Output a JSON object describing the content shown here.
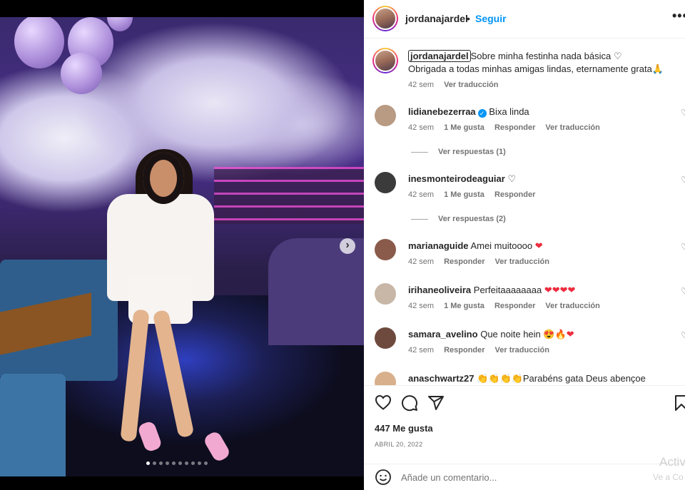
{
  "post": {
    "username": "jordanajardel",
    "separator": "•",
    "follow_label": "Seguir",
    "more_label": "•••",
    "caption_line1": "Sobre minha festinha nada básica ♡",
    "caption_line2": "Obrigada a todas minhas amigas lindas, eternamente grata🙏",
    "caption_time": "42 sem",
    "caption_translate": "Ver traducción",
    "likes": "447 Me gusta",
    "date": "ABRIL 20, 2022",
    "comment_placeholder": "Añade un comentario...",
    "carousel": {
      "total_slides": 10,
      "active_slide": 1
    }
  },
  "comments": [
    {
      "user": "lidianebezerraa",
      "verified": true,
      "text": "Bixa linda",
      "time": "42 sem",
      "likes": "1 Me gusta",
      "reply": "Responder",
      "translate": "Ver traducción",
      "replies": "Ver respuestas (1)"
    },
    {
      "user": "inesmonteirodeaguiar",
      "verified": false,
      "text": "♡",
      "time": "42 sem",
      "likes": "1 Me gusta",
      "reply": "Responder",
      "translate": "",
      "replies": "Ver respuestas (2)"
    },
    {
      "user": "marianaguide",
      "verified": false,
      "text": "Amei muitoooo ❤",
      "time": "42 sem",
      "likes": "",
      "reply": "Responder",
      "translate": "Ver traducción",
      "replies": ""
    },
    {
      "user": "irihaneoliveira",
      "verified": false,
      "text": "Perfeitaaaaaaaa ❤❤❤❤",
      "time": "42 sem",
      "likes": "1 Me gusta",
      "reply": "Responder",
      "translate": "Ver traducción",
      "replies": ""
    },
    {
      "user": "samara_avelino",
      "verified": false,
      "text": "Que noite hein 😍🔥❤",
      "time": "42 sem",
      "likes": "",
      "reply": "Responder",
      "translate": "Ver traducción",
      "replies": ""
    },
    {
      "user": "anaschwartz27",
      "verified": false,
      "text": "👏👏👏👏Parabéns gata Deus abençoe",
      "time": "",
      "likes": "",
      "reply": "",
      "translate": "",
      "replies": ""
    }
  ],
  "watermark": {
    "line1": "Activ",
    "line2": "Ve a Co"
  },
  "icons": {
    "heart": "heart-icon",
    "comment": "comment-icon",
    "share": "send-icon",
    "save": "bookmark-icon",
    "emoji": "emoji-icon",
    "next": "chevron-right-icon"
  },
  "colors": {
    "link": "#0095f6",
    "muted": "#737373",
    "text": "#262626",
    "heart_red": "#ed2b3d"
  }
}
